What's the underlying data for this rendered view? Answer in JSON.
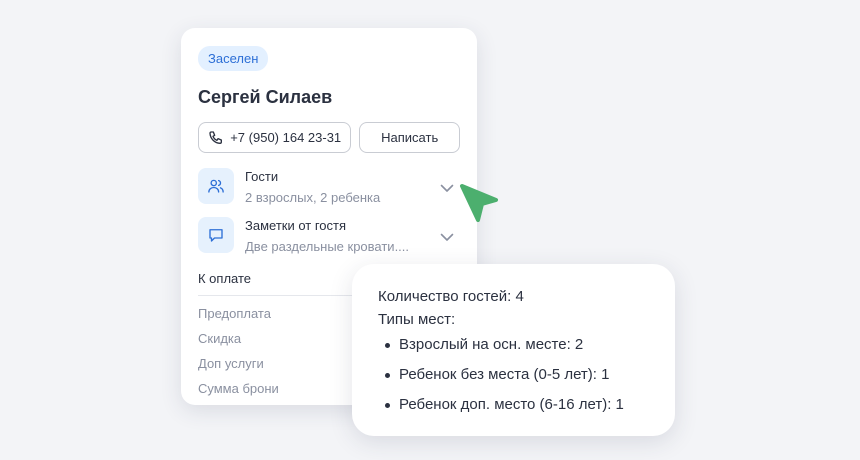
{
  "guest_card": {
    "status_badge": "Заселен",
    "guest_name": "Сергей Силаев",
    "phone_label": "+7 (950) 164 23-31",
    "write_button_label": "Написать",
    "guests": {
      "title": "Гости",
      "subtitle": "2 взрослых, 2 ребенка",
      "icon": "users-icon"
    },
    "notes": {
      "title": "Заметки от гостя",
      "subtitle": "Две раздельные кровати....",
      "icon": "chat-icon"
    },
    "payment": {
      "title": "К оплате",
      "items": [
        "Предоплата",
        "Скидка",
        "Доп услуги",
        "Сумма брони"
      ]
    }
  },
  "guests_popup": {
    "count_line": "Количество гостей: 4",
    "types_title": "Типы мест:",
    "items": [
      "Взрослый на осн. месте: 2",
      "Ребенок без места (0-5 лет): 1",
      "Ребенок доп. место (6-16 лет): 1"
    ]
  },
  "colors": {
    "badge_bg": "#e3f0ff",
    "badge_text": "#2d6fd6",
    "icon_tile": "#e6f1fd",
    "cursor": "#4caf6e"
  }
}
